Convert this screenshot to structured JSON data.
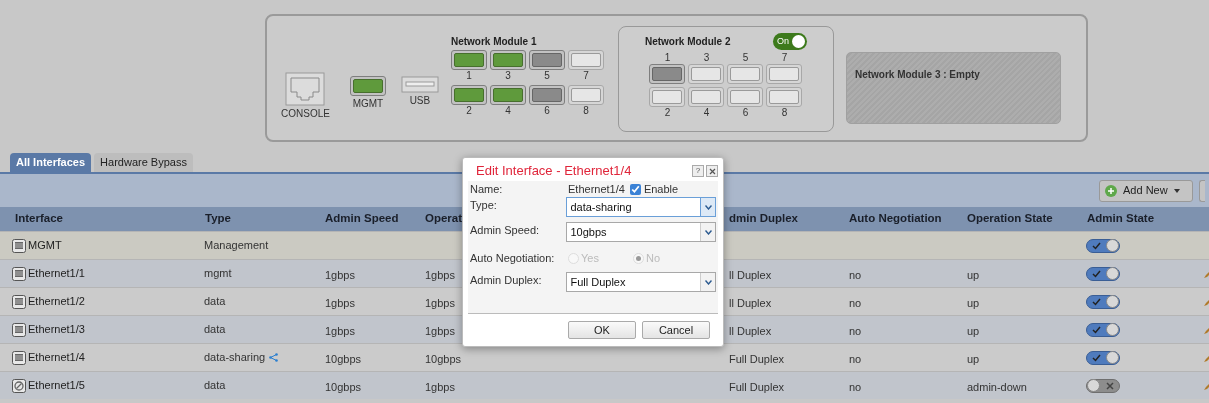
{
  "chassis": {
    "console": {
      "label": "CONSOLE"
    },
    "mgmt_port": {
      "label": "MGMT",
      "populated": true,
      "link_up": true
    },
    "usb": {
      "label": "USB"
    },
    "modules": [
      {
        "kind": "inline",
        "title": "Network Module 1",
        "ports": [
          {
            "label": "1",
            "populated": true,
            "link_up": true
          },
          {
            "label": "2",
            "populated": true,
            "link_up": true
          },
          {
            "label": "3",
            "populated": true,
            "link_up": true
          },
          {
            "label": "4",
            "populated": true,
            "link_up": true
          },
          {
            "label": "5",
            "populated": true,
            "link_up": false
          },
          {
            "label": "6",
            "populated": true,
            "link_up": false
          },
          {
            "label": "7",
            "populated": false,
            "link_up": false
          },
          {
            "label": "8",
            "populated": false,
            "link_up": false
          }
        ]
      },
      {
        "kind": "card",
        "title": "Network Module 2",
        "toggle": {
          "label": "On",
          "on": true
        },
        "ports": [
          {
            "label": "1",
            "populated": true,
            "link_up": false
          },
          {
            "label": "2",
            "populated": false,
            "link_up": false
          },
          {
            "label": "3",
            "populated": false,
            "link_up": false
          },
          {
            "label": "4",
            "populated": false,
            "link_up": false
          },
          {
            "label": "5",
            "populated": false,
            "link_up": false
          },
          {
            "label": "6",
            "populated": false,
            "link_up": false
          },
          {
            "label": "7",
            "populated": false,
            "link_up": false
          },
          {
            "label": "8",
            "populated": false,
            "link_up": false
          }
        ]
      },
      {
        "kind": "empty",
        "title": "Network Module 3 : Empty"
      }
    ]
  },
  "tabs": [
    {
      "label": "All Interfaces",
      "selected": true
    },
    {
      "label": "Hardware Bypass",
      "selected": false
    }
  ],
  "toolbar": {
    "add_button": "Add New"
  },
  "table": {
    "columns": [
      "Interface",
      "Type",
      "Admin Speed",
      "Operat",
      "dmin Duplex",
      "Auto Negotiation",
      "Operation State",
      "Admin State"
    ],
    "rows": [
      {
        "interface": "MGMT",
        "type": "Management",
        "shared": false,
        "admin_speed": "",
        "operation_speed": "",
        "admin_duplex": "",
        "auto_negotiation": "",
        "operation_state": "",
        "admin_state_on": true,
        "management": true
      },
      {
        "interface": "Ethernet1/1",
        "type": "mgmt",
        "shared": false,
        "admin_speed": "1gbps",
        "operation_speed": "1gbps",
        "admin_duplex": "ll Duplex",
        "auto_negotiation": "no",
        "operation_state": "up",
        "admin_state_on": true,
        "management": false
      },
      {
        "interface": "Ethernet1/2",
        "type": "data",
        "shared": false,
        "admin_speed": "1gbps",
        "operation_speed": "1gbps",
        "admin_duplex": "ll Duplex",
        "auto_negotiation": "no",
        "operation_state": "up",
        "admin_state_on": true,
        "management": false
      },
      {
        "interface": "Ethernet1/3",
        "type": "data",
        "shared": false,
        "admin_speed": "1gbps",
        "operation_speed": "1gbps",
        "admin_duplex": "ll Duplex",
        "auto_negotiation": "no",
        "operation_state": "up",
        "admin_state_on": true,
        "management": false
      },
      {
        "interface": "Ethernet1/4",
        "type": "data-sharing",
        "shared": true,
        "admin_speed": "10gbps",
        "operation_speed": "10gbps",
        "admin_duplex": "Full Duplex",
        "auto_negotiation": "no",
        "operation_state": "up",
        "admin_state_on": true,
        "management": false
      },
      {
        "interface": "Ethernet1/5",
        "type": "data",
        "shared": false,
        "admin_speed": "10gbps",
        "operation_speed": "1gbps",
        "admin_duplex": "Full Duplex",
        "auto_negotiation": "no",
        "operation_state": "admin-down",
        "admin_state_on": false,
        "management": false
      }
    ]
  },
  "dialog": {
    "title": "Edit Interface - Ethernet1/4",
    "help": "?",
    "name_label": "Name:",
    "name_value": "Ethernet1/4",
    "enable": {
      "label": "Enable",
      "checked": true
    },
    "fields": [
      {
        "label": "Type:",
        "value": "data-sharing",
        "focused": true
      },
      {
        "label": "Admin Speed:",
        "value": "10gbps",
        "focused": false
      }
    ],
    "auto_negotiation": {
      "label": "Auto Negotiation:",
      "disabled": true,
      "options": [
        {
          "label": "Yes",
          "selected": false
        },
        {
          "label": "No",
          "selected": true
        }
      ]
    },
    "duplex": {
      "label": "Admin Duplex:",
      "value": "Full Duplex",
      "focused": false
    },
    "buttons": [
      "OK",
      "Cancel"
    ]
  }
}
